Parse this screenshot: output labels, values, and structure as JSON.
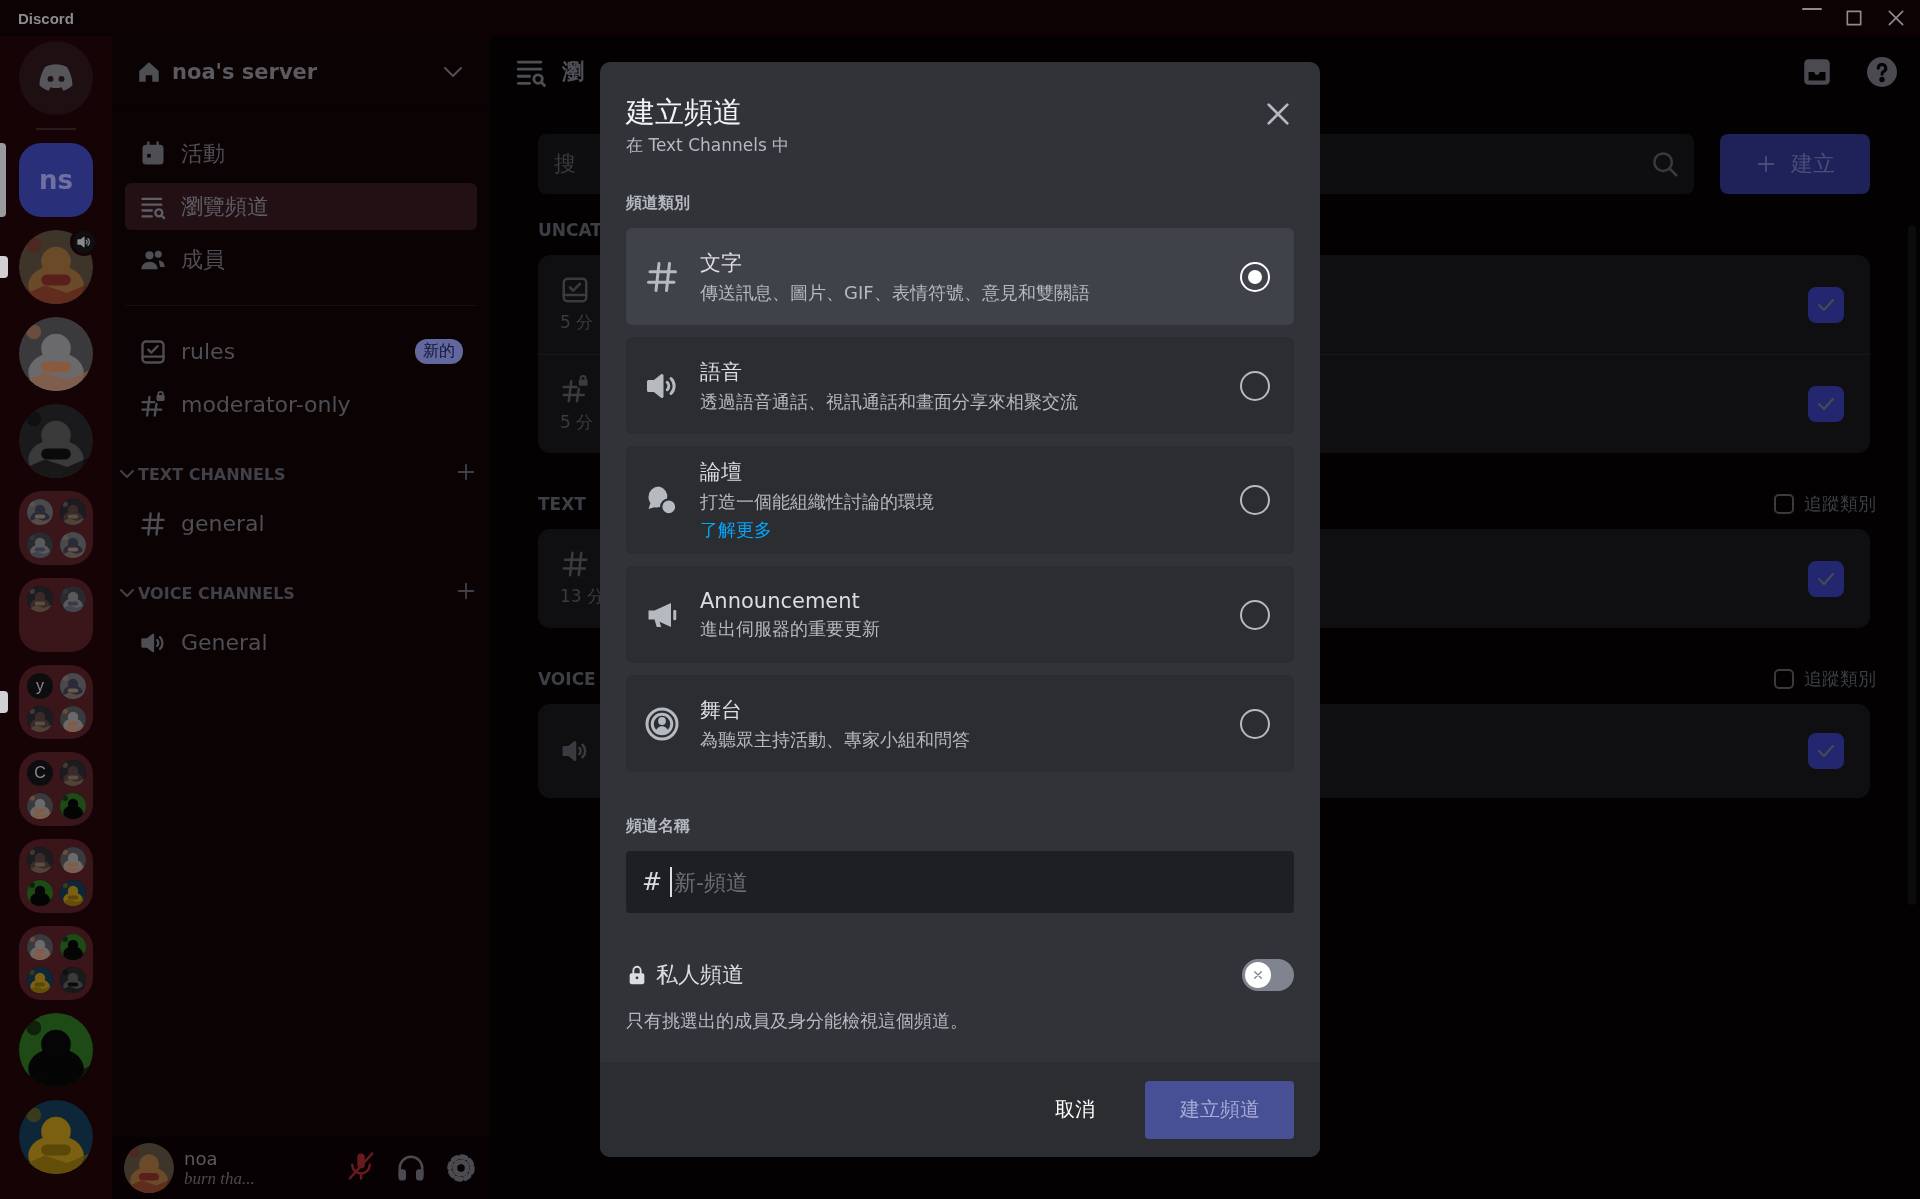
{
  "app_title": "Discord",
  "servers": [
    {
      "kind": "home",
      "selected": false,
      "unread": false,
      "speaking": false
    },
    {
      "kind": "text",
      "label": "ns",
      "selected": true,
      "unread": false,
      "speaking": false
    },
    {
      "kind": "picture",
      "selected": false,
      "unread": true,
      "speaking": true
    },
    {
      "kind": "picture",
      "selected": false,
      "unread": false,
      "speaking": false
    },
    {
      "kind": "picture",
      "selected": false,
      "unread": false,
      "speaking": false
    },
    {
      "kind": "folder",
      "selected": false,
      "unread": false,
      "speaking": false,
      "icons": [
        {
          "kind": "picture"
        },
        {
          "kind": "picture"
        },
        {
          "kind": "picture"
        },
        {
          "kind": "picture"
        }
      ]
    },
    {
      "kind": "folder",
      "selected": false,
      "unread": false,
      "speaking": false,
      "icons": [
        {
          "kind": "picture"
        },
        {
          "kind": "picture"
        }
      ]
    },
    {
      "kind": "folder",
      "selected": false,
      "unread": true,
      "speaking": false,
      "icons": [
        {
          "kind": "text",
          "label": "y"
        },
        {
          "kind": "picture"
        },
        {
          "kind": "picture"
        },
        {
          "kind": "picture"
        }
      ]
    },
    {
      "kind": "folder",
      "selected": false,
      "unread": false,
      "speaking": false,
      "icons": [
        {
          "kind": "text",
          "label": "C"
        },
        {
          "kind": "picture"
        },
        {
          "kind": "picture"
        },
        {
          "kind": "picture"
        }
      ]
    },
    {
      "kind": "folder",
      "selected": false,
      "unread": false,
      "speaking": false,
      "icons": [
        {
          "kind": "picture"
        },
        {
          "kind": "picture"
        },
        {
          "kind": "picture"
        },
        {
          "kind": "picture"
        }
      ]
    },
    {
      "kind": "folder",
      "selected": false,
      "unread": false,
      "speaking": false,
      "icons": [
        {
          "kind": "picture"
        },
        {
          "kind": "picture"
        },
        {
          "kind": "picture"
        },
        {
          "kind": "picture"
        }
      ]
    },
    {
      "kind": "picture",
      "selected": false,
      "unread": false,
      "speaking": false
    },
    {
      "kind": "picture",
      "selected": false,
      "unread": false,
      "speaking": false
    }
  ],
  "server": {
    "name": "noa's server"
  },
  "nav": [
    {
      "kind": "calendar",
      "label": "活動",
      "selected": false
    },
    {
      "kind": "browse",
      "label": "瀏覽頻道",
      "selected": true
    },
    {
      "kind": "members",
      "label": "成員",
      "selected": false
    }
  ],
  "channels": [
    {
      "kind": "rules",
      "name": "rules",
      "badge": "新的"
    },
    {
      "kind": "locked-text",
      "name": "moderator-only"
    }
  ],
  "categories": [
    {
      "name": "TEXT CHANNELS",
      "expanded": true,
      "channels": [
        {
          "kind": "text",
          "name": "general"
        }
      ]
    },
    {
      "name": "VOICE CHANNELS",
      "expanded": true,
      "channels": [
        {
          "kind": "voice",
          "name": "General"
        }
      ]
    }
  ],
  "user": {
    "name": "noa",
    "status": "burn tha...",
    "muted": true
  },
  "browse": {
    "title": "瀏",
    "search_placeholder": "搜",
    "create_button": "建立",
    "sections": [
      {
        "label": "UNCAT",
        "rows": [
          {
            "kind": "rules",
            "time": "5 分",
            "checked": true
          },
          {
            "kind": "locked-text",
            "time": "5 分",
            "checked": true
          }
        ]
      },
      {
        "label": "TEXT",
        "follow": {
          "label": "追蹤類別",
          "checked": false
        },
        "rows": [
          {
            "kind": "text",
            "time": "13 分",
            "checked": true
          }
        ]
      },
      {
        "label": "VOICE",
        "follow": {
          "label": "追蹤類別",
          "checked": false
        },
        "rows": [
          {
            "kind": "voice",
            "checked": true
          }
        ]
      }
    ]
  },
  "modal": {
    "title": "建立頻道",
    "subtitle": "在 Text Channels 中",
    "type_label": "頻道類別",
    "types": [
      {
        "kind": "text",
        "name": "文字",
        "description": "傳送訊息、圖片、GIF、表情符號、意見和雙關語",
        "selected": true
      },
      {
        "kind": "voice",
        "name": "語音",
        "description": "透過語音通話、視訊通話和畫面分享來相聚交流",
        "selected": false
      },
      {
        "kind": "forum",
        "name": "論壇",
        "description": "打造一個能組織性討論的環境",
        "link": "了解更多",
        "selected": false
      },
      {
        "kind": "announcement",
        "name": "Announcement",
        "description": "進出伺服器的重要更新",
        "selected": false
      },
      {
        "kind": "stage",
        "name": "舞台",
        "description": "為聽眾主持活動、專家小組和問答",
        "selected": false
      }
    ],
    "name_label": "頻道名稱",
    "name_field": {
      "prefix": "#",
      "placeholder": "新-頻道"
    },
    "private": {
      "label": "私人頻道",
      "on": false,
      "description": "只有挑選出的成員及身分能檢視這個頻道。"
    },
    "buttons": [
      {
        "kind": "cancel",
        "label": "取消"
      },
      {
        "kind": "primary",
        "label": "建立頻道",
        "disabled": true
      }
    ]
  }
}
